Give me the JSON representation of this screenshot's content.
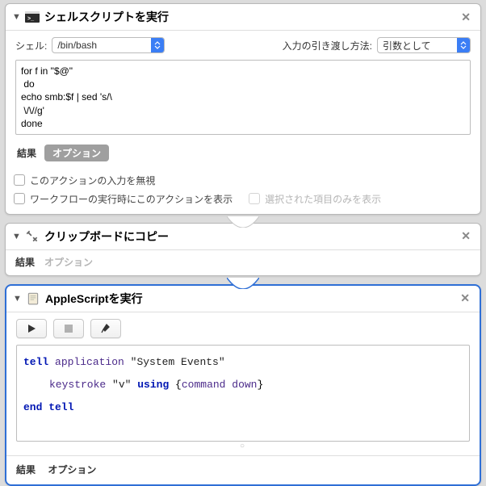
{
  "action1": {
    "title": "シェルスクリプトを実行",
    "shell_label": "シェル:",
    "shell_value": "/bin/bash",
    "input_label": "入力の引き渡し方法:",
    "input_value": "引数として",
    "code": "for f in \"$@\"\n do\necho smb:$f | sed 's/\\\n \\/\\//g'\ndone",
    "tab_results": "結果",
    "tab_options": "オプション",
    "check_ignore": "このアクションの入力を無視",
    "check_show": "ワークフローの実行時にこのアクションを表示",
    "check_selected_only": "選択された項目のみを表示"
  },
  "action2": {
    "title": "クリップボードにコピー",
    "tab_results": "結果",
    "tab_options": "オプション"
  },
  "action3": {
    "title": "AppleScriptを実行",
    "tab_results": "結果",
    "tab_options": "オプション",
    "script": {
      "l1_kw1": "tell",
      "l1_app": " application",
      "l1_str": " \"System Events\"",
      "l2_cmd": "keystroke",
      "l2_str": " \"v\" ",
      "l2_using": "using",
      "l2_brace": " {",
      "l2_mod": "command down",
      "l2_close": "}",
      "l3_kw": "end tell"
    }
  }
}
